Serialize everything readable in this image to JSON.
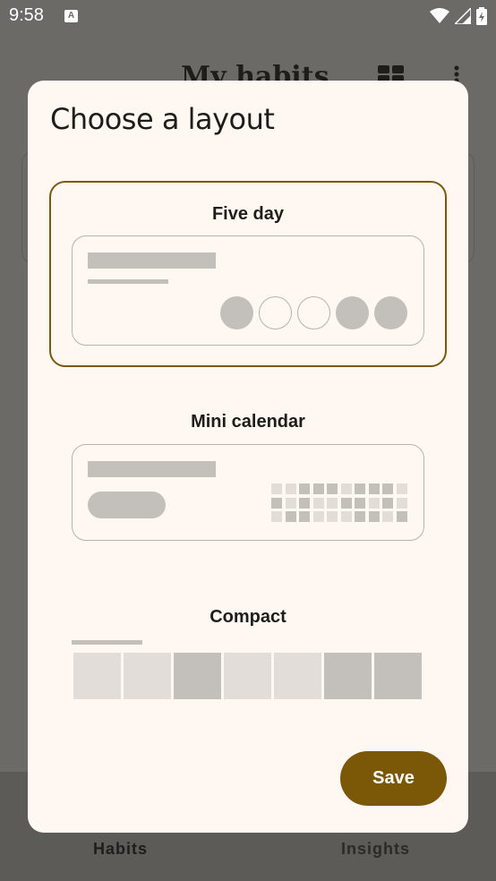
{
  "status_bar": {
    "time": "9:58",
    "notification_icon": "text-a-icon",
    "icons": [
      "wifi-icon",
      "signal-icon",
      "battery-icon"
    ]
  },
  "background": {
    "title": "My habits",
    "nav": {
      "habits": "Habits",
      "insights": "Insights"
    }
  },
  "dialog": {
    "title": "Choose a layout",
    "options": [
      {
        "label": "Five day",
        "selected": true,
        "circles": [
          "filled",
          "empty",
          "empty",
          "filled",
          "filled"
        ]
      },
      {
        "label": "Mini calendar",
        "selected": false
      },
      {
        "label": "Compact",
        "selected": false,
        "cells": [
          "l",
          "l",
          "d",
          "l",
          "l",
          "d",
          "d"
        ]
      }
    ],
    "save_label": "Save"
  },
  "colors": {
    "accent": "#7a5808",
    "dialog_bg": "#fff7f2",
    "scrim": "#6b6a66",
    "placeholder_dark": "#c3bfba",
    "placeholder_light": "#e2ddd8"
  }
}
